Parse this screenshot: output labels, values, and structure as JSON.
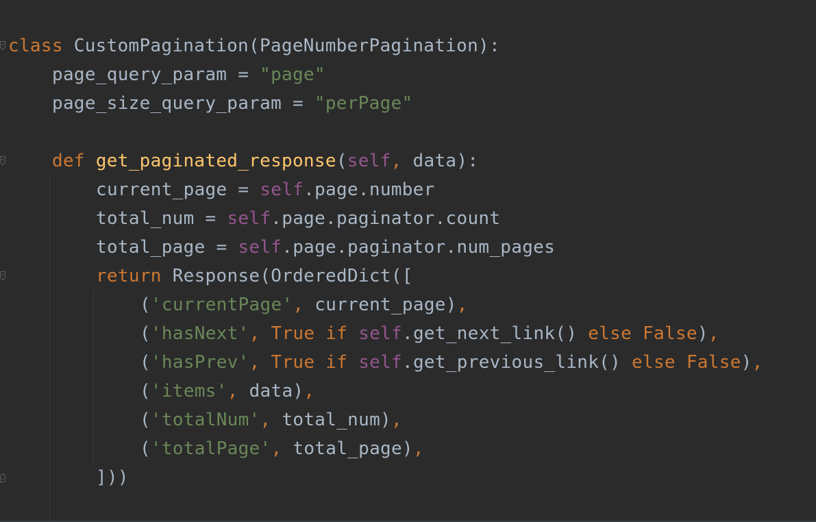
{
  "editor": {
    "language": "python",
    "colors": {
      "background": "#2b2b2b",
      "text": "#a9b7c6",
      "keyword": "#cc7832",
      "function": "#ffc66d",
      "string": "#6a8759",
      "self": "#94558d"
    },
    "lines": [
      {
        "indent": 0,
        "fold": "open",
        "tokens": [
          {
            "t": "class",
            "k": "keyword"
          },
          {
            "t": " ",
            "k": "plain"
          },
          {
            "t": "CustomPagination",
            "k": "class-name"
          },
          {
            "t": "(PageNumberPagination):",
            "k": "plain"
          }
        ]
      },
      {
        "indent": 1,
        "tokens": [
          {
            "t": "page_query_param = ",
            "k": "plain"
          },
          {
            "t": "\"page\"",
            "k": "string"
          }
        ]
      },
      {
        "indent": 1,
        "tokens": [
          {
            "t": "page_size_query_param = ",
            "k": "plain"
          },
          {
            "t": "\"perPage\"",
            "k": "string"
          }
        ]
      },
      {
        "indent": 0,
        "tokens": []
      },
      {
        "indent": 1,
        "fold": "open",
        "tokens": [
          {
            "t": "def",
            "k": "keyword"
          },
          {
            "t": " ",
            "k": "plain"
          },
          {
            "t": "get_paginated_response",
            "k": "function"
          },
          {
            "t": "(",
            "k": "plain"
          },
          {
            "t": "self",
            "k": "self"
          },
          {
            "t": ",",
            "k": "punct"
          },
          {
            "t": " data):",
            "k": "plain"
          }
        ]
      },
      {
        "indent": 2,
        "tokens": [
          {
            "t": "current_page = ",
            "k": "plain"
          },
          {
            "t": "self",
            "k": "self"
          },
          {
            "t": ".page.number",
            "k": "plain"
          }
        ]
      },
      {
        "indent": 2,
        "tokens": [
          {
            "t": "total_num = ",
            "k": "plain"
          },
          {
            "t": "self",
            "k": "self"
          },
          {
            "t": ".page.paginator.count",
            "k": "plain"
          }
        ]
      },
      {
        "indent": 2,
        "tokens": [
          {
            "t": "total_page = ",
            "k": "plain"
          },
          {
            "t": "self",
            "k": "self"
          },
          {
            "t": ".page.paginator.num_pages",
            "k": "plain"
          }
        ]
      },
      {
        "indent": 2,
        "fold": "open",
        "tokens": [
          {
            "t": "return",
            "k": "keyword"
          },
          {
            "t": " Response(OrderedDict([",
            "k": "plain"
          }
        ]
      },
      {
        "indent": 3,
        "tokens": [
          {
            "t": "(",
            "k": "plain"
          },
          {
            "t": "'currentPage'",
            "k": "string"
          },
          {
            "t": ",",
            "k": "punct"
          },
          {
            "t": " current_page)",
            "k": "plain"
          },
          {
            "t": ",",
            "k": "punct"
          }
        ]
      },
      {
        "indent": 3,
        "tokens": [
          {
            "t": "(",
            "k": "plain"
          },
          {
            "t": "'hasNext'",
            "k": "string"
          },
          {
            "t": ",",
            "k": "punct"
          },
          {
            "t": " ",
            "k": "plain"
          },
          {
            "t": "True",
            "k": "keyword"
          },
          {
            "t": " ",
            "k": "plain"
          },
          {
            "t": "if",
            "k": "keyword"
          },
          {
            "t": " ",
            "k": "plain"
          },
          {
            "t": "self",
            "k": "self"
          },
          {
            "t": ".get_next_link() ",
            "k": "plain"
          },
          {
            "t": "else",
            "k": "keyword"
          },
          {
            "t": " ",
            "k": "plain"
          },
          {
            "t": "False",
            "k": "keyword"
          },
          {
            "t": ")",
            "k": "plain"
          },
          {
            "t": ",",
            "k": "punct"
          }
        ]
      },
      {
        "indent": 3,
        "tokens": [
          {
            "t": "(",
            "k": "plain"
          },
          {
            "t": "'hasPrev'",
            "k": "string"
          },
          {
            "t": ",",
            "k": "punct"
          },
          {
            "t": " ",
            "k": "plain"
          },
          {
            "t": "True",
            "k": "keyword"
          },
          {
            "t": " ",
            "k": "plain"
          },
          {
            "t": "if",
            "k": "keyword"
          },
          {
            "t": " ",
            "k": "plain"
          },
          {
            "t": "self",
            "k": "self"
          },
          {
            "t": ".get_previous_link() ",
            "k": "plain"
          },
          {
            "t": "else",
            "k": "keyword"
          },
          {
            "t": " ",
            "k": "plain"
          },
          {
            "t": "False",
            "k": "keyword"
          },
          {
            "t": ")",
            "k": "plain"
          },
          {
            "t": ",",
            "k": "punct"
          }
        ]
      },
      {
        "indent": 3,
        "tokens": [
          {
            "t": "(",
            "k": "plain"
          },
          {
            "t": "'items'",
            "k": "string"
          },
          {
            "t": ",",
            "k": "punct"
          },
          {
            "t": " data)",
            "k": "plain"
          },
          {
            "t": ",",
            "k": "punct"
          }
        ]
      },
      {
        "indent": 3,
        "tokens": [
          {
            "t": "(",
            "k": "plain"
          },
          {
            "t": "'totalNum'",
            "k": "string"
          },
          {
            "t": ",",
            "k": "punct"
          },
          {
            "t": " total_num)",
            "k": "plain"
          },
          {
            "t": ",",
            "k": "punct"
          }
        ]
      },
      {
        "indent": 3,
        "tokens": [
          {
            "t": "(",
            "k": "plain"
          },
          {
            "t": "'totalPage'",
            "k": "string"
          },
          {
            "t": ",",
            "k": "punct"
          },
          {
            "t": " total_page)",
            "k": "plain"
          },
          {
            "t": ",",
            "k": "punct"
          }
        ]
      },
      {
        "indent": 2,
        "fold": "close",
        "tokens": [
          {
            "t": "]))",
            "k": "plain"
          }
        ]
      }
    ]
  }
}
